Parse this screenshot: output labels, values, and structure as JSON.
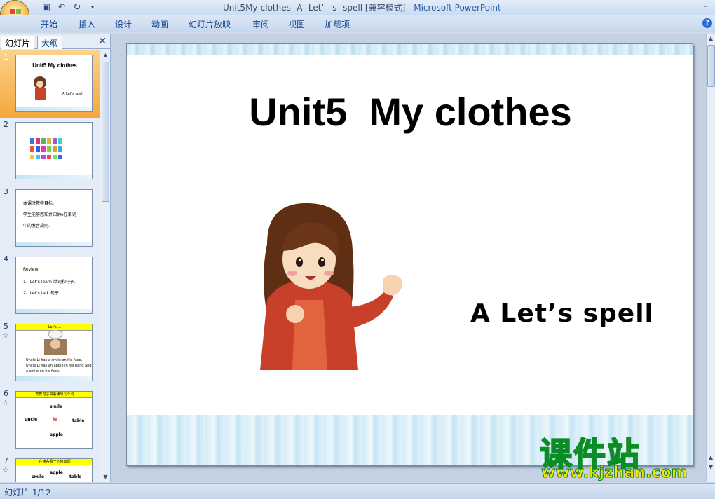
{
  "window": {
    "title": "Unit5My-clothes--A--Let’　s--spell [兼容模式]",
    "app_name": "- Microsoft PowerPoint"
  },
  "ribbon": {
    "tabs": [
      "开始",
      "插入",
      "设计",
      "动画",
      "幻灯片放映",
      "审阅",
      "视图",
      "加载项"
    ]
  },
  "left_panel": {
    "tabs": [
      "幻灯片",
      "大纲"
    ],
    "thumbnails": [
      {
        "num": "1",
        "title": "Unit5 My clothes",
        "sub": "A Let's spell"
      },
      {
        "num": "2"
      },
      {
        "num": "3",
        "lines": [
          "本课时教学目标:",
          "学生能够感知并归纳e在单词",
          "中的发音规则."
        ]
      },
      {
        "num": "4",
        "lines": [
          "Review:",
          "1、Let's learn 单词和句子.",
          "2、Let's talk 句子."
        ]
      },
      {
        "num": "5",
        "bar": "Let's …",
        "lines": [
          "Uncle Li has a smile on his face.",
          "Uncle Li has an apple in his hand and",
          "a smile on his face."
        ]
      },
      {
        "num": "6",
        "bar": "帮帮句子中看读出几个词",
        "words": [
          "smile",
          "uncle",
          "le",
          "table",
          "apple"
        ]
      },
      {
        "num": "7",
        "bar": "在读各看一下读单词",
        "words": [
          "smile",
          "apple",
          "table"
        ]
      }
    ]
  },
  "slide": {
    "title": "Unit5  My clothes",
    "subtitle": "A Let’s spell"
  },
  "status": {
    "text": "幻灯片 1/12"
  },
  "watermark": {
    "cn": "课件站",
    "url": "www.kjzhan.com"
  }
}
